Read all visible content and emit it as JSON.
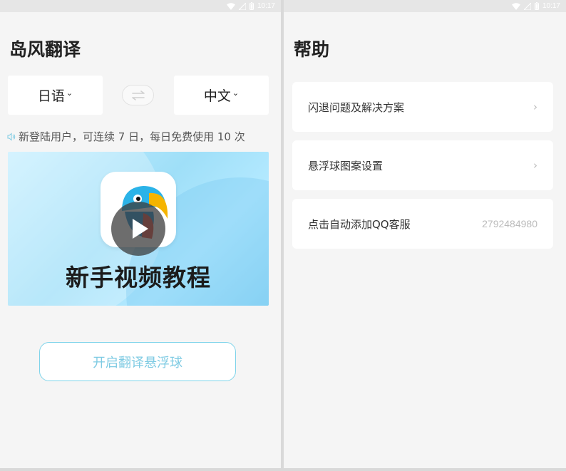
{
  "status_bar": {
    "time": "10:17"
  },
  "translate_screen": {
    "title": "岛风翻译",
    "source_language": "日语",
    "target_language": "中文",
    "notice": "新登陆用户，可连续 7 日，每日免费使用 10 次",
    "banner_text": "新手视频教程",
    "float_button": "开启翻译悬浮球"
  },
  "help_screen": {
    "title": "帮助",
    "items": [
      {
        "label": "闪退问题及解决方案"
      },
      {
        "label": "悬浮球图案设置"
      },
      {
        "label": "点击自动添加QQ客服",
        "value": "2792484980"
      }
    ]
  },
  "colors": {
    "accent": "#7fd4ea",
    "background": "#f5f5f5"
  }
}
